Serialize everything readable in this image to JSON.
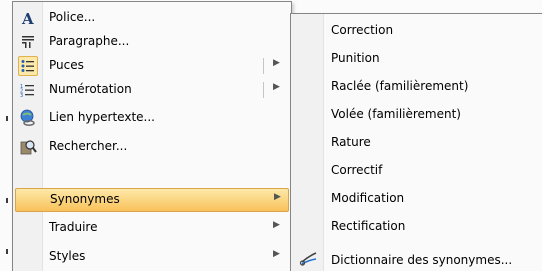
{
  "context_menu": {
    "items": [
      {
        "label": "Police...",
        "icon": "font-icon"
      },
      {
        "label": "Paragraphe...",
        "icon": "paragraph-icon"
      },
      {
        "label": "Puces",
        "icon": "bullets-icon"
      },
      {
        "label": "Numérotation",
        "icon": "numbering-icon"
      },
      {
        "label": "Lien hypertexte...",
        "icon": "hyperlink-icon"
      },
      {
        "label": "Rechercher...",
        "icon": "research-icon"
      },
      {
        "label": "Synonymes",
        "icon": "",
        "highlighted": true
      },
      {
        "label": "Traduire",
        "icon": ""
      },
      {
        "label": "Styles",
        "icon": ""
      }
    ]
  },
  "synonyms_submenu": {
    "items": [
      {
        "label": "Correction"
      },
      {
        "label": "Punition"
      },
      {
        "label": "Raclée (familièrement)"
      },
      {
        "label": "Volée (familièrement)"
      },
      {
        "label": "Rature"
      },
      {
        "label": "Correctif"
      },
      {
        "label": "Modification"
      },
      {
        "label": "Rectification"
      },
      {
        "label": "Dictionnaire des synonymes...",
        "icon": "thesaurus-icon"
      }
    ]
  },
  "colors": {
    "highlight": "#f9c15a",
    "gutter": "#f1f1f1",
    "border": "#868686"
  }
}
